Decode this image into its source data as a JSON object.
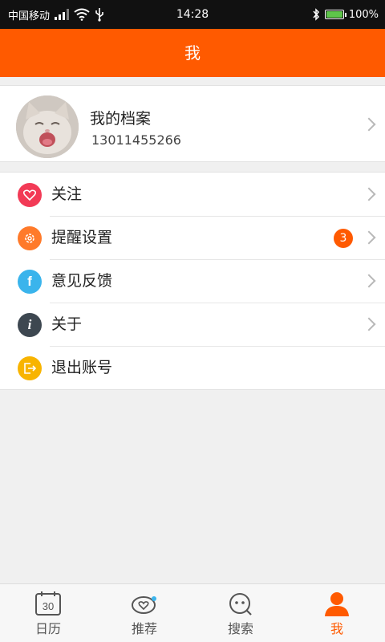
{
  "status_bar": {
    "carrier": "中国移动",
    "time": "14:28",
    "battery": "100%",
    "icons": [
      "signal-icon",
      "wifi-icon",
      "usb-icon",
      "bluetooth-icon",
      "battery-icon"
    ]
  },
  "header": {
    "title": "我"
  },
  "profile": {
    "name": "我的档案",
    "phone": "13011455266",
    "avatar": "kitten-avatar"
  },
  "menu": {
    "items": [
      {
        "label": "关注",
        "icon": "heart-icon",
        "color": "#f23a56"
      },
      {
        "label": "提醒设置",
        "icon": "gear-icon",
        "color": "#ff7a2a",
        "badge": "3"
      },
      {
        "label": "意见反馈",
        "icon": "feedback-icon",
        "color": "#3ab4ec"
      },
      {
        "label": "关于",
        "icon": "info-icon",
        "color": "#3d4750"
      },
      {
        "label": "退出账号",
        "icon": "logout-icon",
        "color": "#f8b400"
      }
    ]
  },
  "tabbar": {
    "tabs": [
      {
        "label": "日历",
        "icon": "calendar-icon"
      },
      {
        "label": "推荐",
        "icon": "recommend-icon"
      },
      {
        "label": "搜索",
        "icon": "search-icon"
      },
      {
        "label": "我",
        "icon": "profile-icon",
        "active": true
      }
    ]
  },
  "colors": {
    "accent": "#ff5a00",
    "badge": "#ff5a00"
  }
}
